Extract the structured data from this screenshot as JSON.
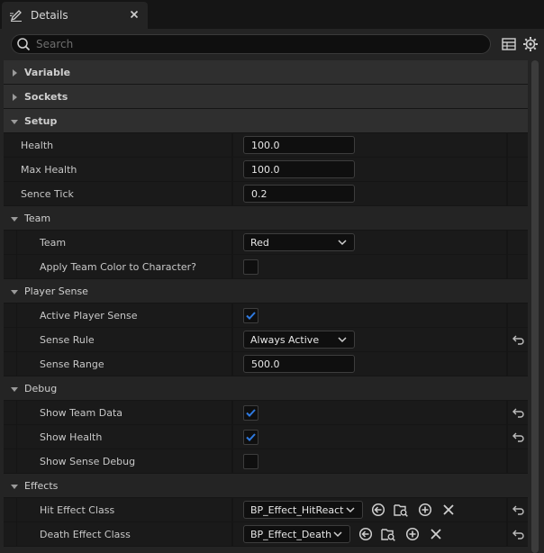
{
  "window": {
    "tab_title": "Details",
    "tab_icon": "pencil-icon",
    "close_icon": "close-icon"
  },
  "search": {
    "placeholder": "Search",
    "value": ""
  },
  "toolbar": {
    "icons": [
      "table-view-icon",
      "settings-gear-icon"
    ]
  },
  "categories": {
    "variable": "Variable",
    "sockets": "Sockets",
    "setup": "Setup",
    "team": "Team",
    "player_sense": "Player Sense",
    "debug": "Debug",
    "effects": "Effects"
  },
  "setup": {
    "health": {
      "label": "Health",
      "value": "100.0"
    },
    "max_health": {
      "label": "Max Health",
      "value": "100.0"
    },
    "sence_tick": {
      "label": "Sence Tick",
      "value": "0.2"
    }
  },
  "team": {
    "team": {
      "label": "Team",
      "value": "Red"
    },
    "apply_color": {
      "label": "Apply Team Color to Character?",
      "checked": false
    }
  },
  "player_sense": {
    "active": {
      "label": "Active Player Sense",
      "checked": true
    },
    "rule": {
      "label": "Sense Rule",
      "value": "Always Active",
      "modified": true
    },
    "range": {
      "label": "Sense Range",
      "value": "500.0"
    }
  },
  "debug": {
    "show_team_data": {
      "label": "Show Team Data",
      "checked": true,
      "modified": true
    },
    "show_health": {
      "label": "Show Health",
      "checked": true,
      "modified": true
    },
    "show_sense_debug": {
      "label": "Show Sense Debug",
      "checked": false
    }
  },
  "effects": {
    "hit": {
      "label": "Hit Effect Class",
      "value": "BP_Effect_HitReact",
      "modified": true
    },
    "death": {
      "label": "Death Effect Class",
      "value": "BP_Effect_Death",
      "modified": true
    },
    "action_icons": [
      "use-selected-icon",
      "browse-asset-icon",
      "add-icon",
      "clear-icon"
    ]
  },
  "colors": {
    "panel_bg": "#242424",
    "category_bg": "#2f2f2f",
    "row_bg": "#1a1a1a",
    "input_bg": "#0f0f0f",
    "accent_check": "#2f7ae0"
  }
}
